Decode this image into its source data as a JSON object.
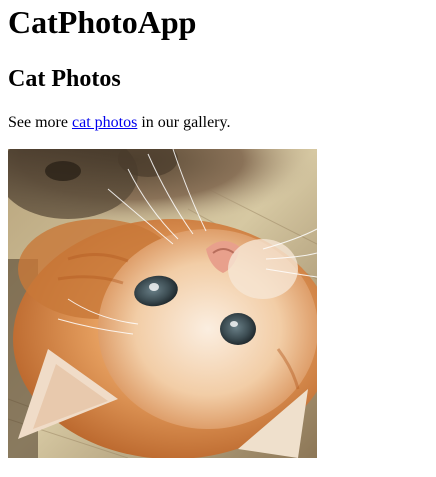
{
  "header": {
    "app_title": "CatPhotoApp"
  },
  "main": {
    "section_title": "Cat Photos",
    "intro": {
      "before_link": "See more ",
      "link_text": "cat photos",
      "after_link": " in our gallery."
    },
    "image": {
      "subject": "relaxing-cat-photo"
    }
  }
}
